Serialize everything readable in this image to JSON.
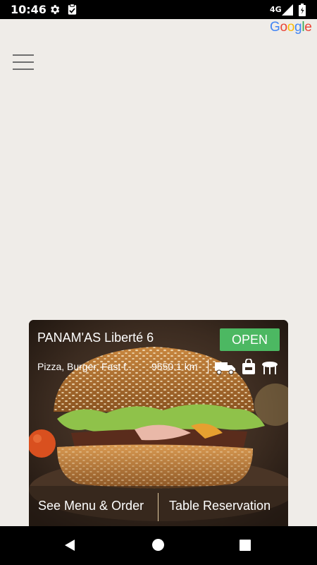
{
  "status_bar": {
    "time": "10:46",
    "network": "4G",
    "icons": [
      "settings-icon",
      "clipboard-check-icon",
      "signal-icon",
      "battery-icon"
    ]
  },
  "map": {
    "provider_logo": "Google",
    "menu_icon": "hamburger-menu-icon"
  },
  "restaurant_card": {
    "name": "PANAM'AS Liberté 6",
    "status": "OPEN",
    "status_color": "#4cb862",
    "cuisine": "Pizza, Burger, Fast f...",
    "distance": "9550.1 km",
    "service_icons": [
      "delivery-truck-icon",
      "takeaway-bag-icon",
      "dine-in-table-icon"
    ],
    "buttons": {
      "menu_order": "See Menu & Order",
      "table_reservation": "Table Reservation"
    }
  },
  "nav_bar": {
    "icons": [
      "back-icon",
      "home-icon",
      "recents-icon"
    ]
  }
}
